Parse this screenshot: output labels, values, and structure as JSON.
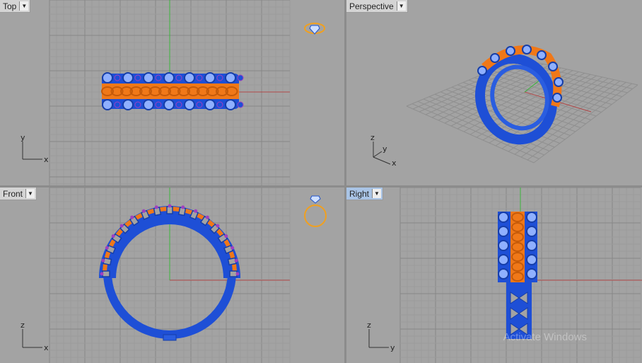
{
  "viewports": {
    "top": {
      "label": "Top",
      "axis1": "y",
      "axis2": "x"
    },
    "perspective": {
      "label": "Perspective",
      "axis_z": "z",
      "axis_y": "y",
      "axis_x": "x"
    },
    "front": {
      "label": "Front",
      "axis1": "z",
      "axis2": "x"
    },
    "right": {
      "label": "Right",
      "axis1": "z",
      "axis2": "y"
    }
  },
  "watermark": "Activate Windows",
  "colors": {
    "viewport_bg": "#a3a3a3",
    "grid_minor": "#999999",
    "grid_major": "#7e7e7e",
    "x_axis": "#b04848",
    "y_axis": "#3cb43c",
    "ring_metal": "#1e4fd6",
    "ring_chain": "#f07818",
    "gem": "#8fb0ff",
    "active_label": "#a9c4e6"
  },
  "icons": {
    "dropdown": "triangle-down",
    "ring_preview": "ring-with-diamond"
  }
}
